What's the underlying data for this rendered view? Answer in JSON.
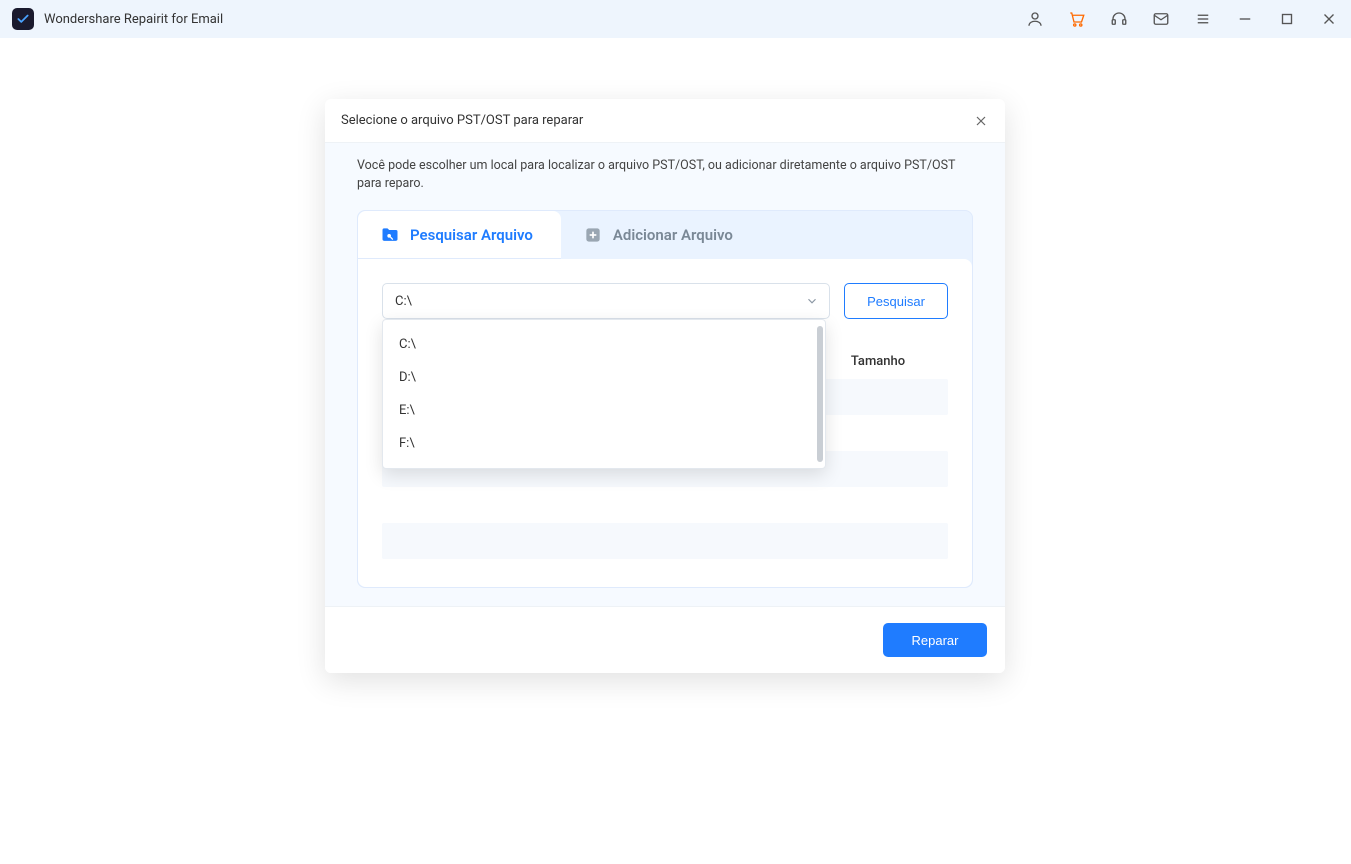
{
  "app": {
    "title": "Wondershare Repairit for Email"
  },
  "dialog": {
    "title": "Selecione o arquivo PST/OST para reparar",
    "instruction": "Você pode escolher um local para localizar o arquivo PST/OST, ou adicionar diretamente o arquivo PST/OST para reparo.",
    "tabs": {
      "search": "Pesquisar Arquivo",
      "add": "Adicionar Arquivo"
    },
    "drive_selected": "C:\\",
    "drive_options": [
      "C:\\",
      "D:\\",
      "E:\\",
      "F:\\"
    ],
    "search_button": "Pesquisar",
    "table": {
      "size_header": "Tamanho"
    },
    "repair_button": "Reparar"
  }
}
